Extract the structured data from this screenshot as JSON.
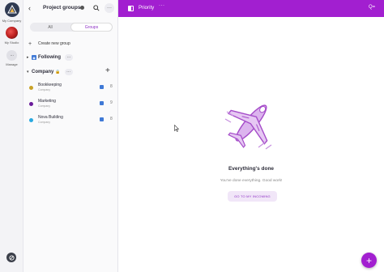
{
  "rail": {
    "workspaces": [
      {
        "label": "My Company",
        "icon": "company-logo-icon"
      },
      {
        "label": "My Studio",
        "icon": "studio-avatar-icon"
      }
    ],
    "manage_label": "Manage",
    "help_icon": "help-icon"
  },
  "sidebar": {
    "title": "Project groups",
    "tabs": [
      {
        "label": "All",
        "active": false
      },
      {
        "label": "Groups",
        "active": true
      }
    ],
    "create_label": "Create new group",
    "sections": [
      {
        "label": "Following",
        "icon": "rss-icon",
        "expanded": false
      },
      {
        "label": "Company",
        "icon": "lock-icon",
        "expanded": true
      }
    ],
    "groups": [
      {
        "name": "Bookkeeping",
        "sub": "Company",
        "count": "8",
        "color": "#c9a227"
      },
      {
        "name": "Marketing",
        "sub": "Company",
        "count": "9",
        "color": "#6a1b9a"
      },
      {
        "name": "Nova Building",
        "sub": "Company",
        "count": "8",
        "color": "#29a9e0"
      }
    ]
  },
  "topbar": {
    "title": "Priority",
    "accent": "#a21fd0",
    "right_label": "Q="
  },
  "main": {
    "empty_title": "Everything's done",
    "empty_subtitle": "You've done everything. Good work!",
    "cta_label": "GO TO MY INCOMING"
  }
}
